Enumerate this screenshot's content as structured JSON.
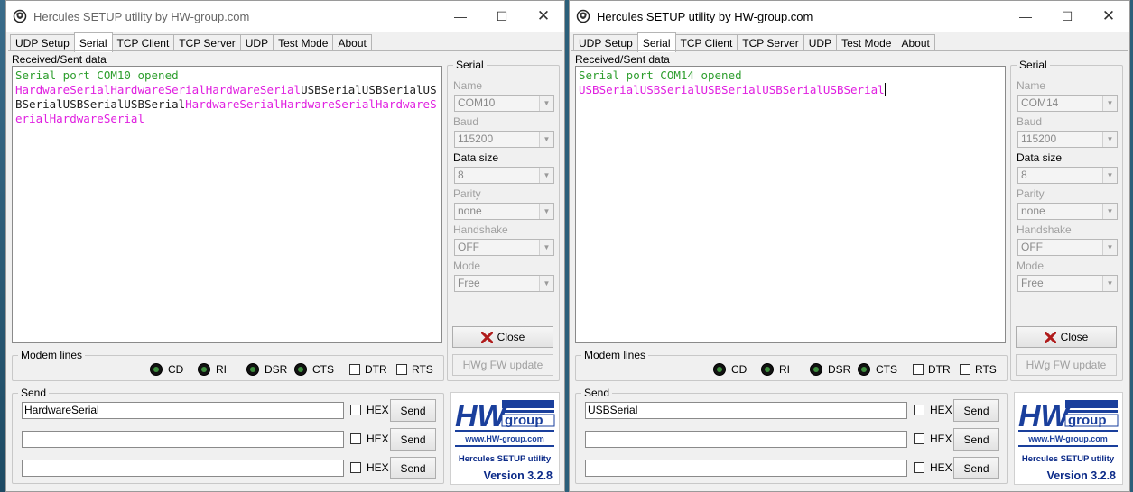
{
  "windows": [
    {
      "title": "Hercules SETUP utility by HW-group.com",
      "tabs": [
        "UDP Setup",
        "Serial",
        "TCP Client",
        "TCP Server",
        "UDP",
        "Test Mode",
        "About"
      ],
      "active_tab": "Serial",
      "received_label": "Received/Sent data",
      "log_opened": "Serial port COM10 opened",
      "log_segments": [
        {
          "text": "HardwareSerialHardwareSerialHardwareSerial",
          "color": "magenta"
        },
        {
          "text": "USBSerialUSBSerialUSBSerialUSBSerialUSBSerial",
          "color": "dark"
        },
        {
          "text": "HardwareSerialHardwareSerialHardwareSerialHardwareSerial",
          "color": "magenta"
        }
      ],
      "serial": {
        "legend": "Serial",
        "name_label": "Name",
        "name_value": "COM10",
        "baud_label": "Baud",
        "baud_value": "115200",
        "datasize_label": "Data size",
        "datasize_value": "8",
        "parity_label": "Parity",
        "parity_value": "none",
        "handshake_label": "Handshake",
        "handshake_value": "OFF",
        "mode_label": "Mode",
        "mode_value": "Free",
        "close_label": "Close",
        "fw_label": "HWg FW update"
      },
      "modem": {
        "legend": "Modem lines",
        "cd": "CD",
        "ri": "RI",
        "dsr": "DSR",
        "cts": "CTS",
        "dtr": "DTR",
        "rts": "RTS"
      },
      "send": {
        "legend": "Send",
        "inputs": [
          "HardwareSerial",
          "",
          ""
        ],
        "hex_label": "HEX",
        "send_label": "Send"
      },
      "logo": {
        "brand": "group",
        "url": "www.HW-group.com",
        "product": "Hercules SETUP utility",
        "version": "Version  3.2.8"
      }
    },
    {
      "title": "Hercules SETUP utility by HW-group.com",
      "tabs": [
        "UDP Setup",
        "Serial",
        "TCP Client",
        "TCP Server",
        "UDP",
        "Test Mode",
        "About"
      ],
      "active_tab": "Serial",
      "received_label": "Received/Sent data",
      "log_opened": "Serial port COM14 opened",
      "log_segments": [
        {
          "text": "USBSerialUSBSerialUSBSerialUSBSerialUSBSerial",
          "color": "magenta"
        }
      ],
      "serial": {
        "legend": "Serial",
        "name_label": "Name",
        "name_value": "COM14",
        "baud_label": "Baud",
        "baud_value": "115200",
        "datasize_label": "Data size",
        "datasize_value": "8",
        "parity_label": "Parity",
        "parity_value": "none",
        "handshake_label": "Handshake",
        "handshake_value": "OFF",
        "mode_label": "Mode",
        "mode_value": "Free",
        "close_label": "Close",
        "fw_label": "HWg FW update"
      },
      "modem": {
        "legend": "Modem lines",
        "cd": "CD",
        "ri": "RI",
        "dsr": "DSR",
        "cts": "CTS",
        "dtr": "DTR",
        "rts": "RTS"
      },
      "send": {
        "legend": "Send",
        "inputs": [
          "USBSerial",
          "",
          ""
        ],
        "hex_label": "HEX",
        "send_label": "Send"
      },
      "logo": {
        "brand": "group",
        "url": "www.HW-group.com",
        "product": "Hercules SETUP utility",
        "version": "Version  3.2.8"
      }
    }
  ],
  "colors": {
    "log_green": "#2e9e2e",
    "log_magenta": "#e020e0",
    "logo_blue": "#1a3f9c",
    "version_blue": "#0b2a88"
  },
  "icons": {
    "app": "hercules-icon",
    "close": "close-x-icon",
    "led": "led-indicator-icon"
  }
}
